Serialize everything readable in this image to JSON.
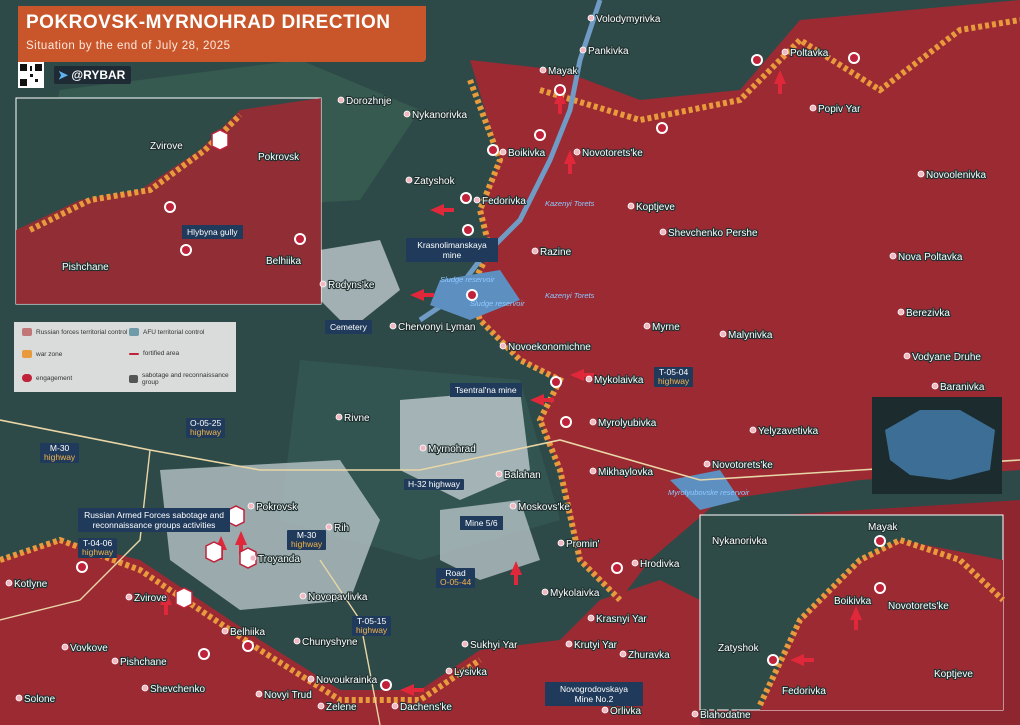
{
  "header": {
    "title": "POKROVSK-MYRNOHRAD DIRECTION",
    "subtitle": "Situation by the end of July 28, 2025"
  },
  "brand": {
    "handle": "@RYBAR"
  },
  "legend": {
    "russian": "Russian forces territorial control",
    "afu": "AFU territorial control",
    "war_zone": "war zone",
    "fortified": "fortified area",
    "engagement": "engagement",
    "sabotage": "sabotage and reconnaissance group"
  },
  "colors": {
    "russian_zone": "#9b2a33",
    "afu_zone": "#2e4a48",
    "war_zone": "#e89b3c",
    "settlement": "#d0d8dc",
    "callout_bg": "#1f3a5a",
    "highway_text": "#f5b54a",
    "header_bg": "#c8562a"
  },
  "icons": [
    "telegram-icon",
    "qr-code",
    "engagement-marker",
    "sabotage-marker",
    "settlement-marker",
    "advance-arrow"
  ],
  "settlements": [
    {
      "name": "Volodymyrivka"
    },
    {
      "name": "Pankivka"
    },
    {
      "name": "Mayak"
    },
    {
      "name": "Poltavka"
    },
    {
      "name": "Popiv Yar"
    },
    {
      "name": "Dorozhnje"
    },
    {
      "name": "Nykanorivka"
    },
    {
      "name": "Boikivka"
    },
    {
      "name": "Novotorets'ke"
    },
    {
      "name": "Novoolenivka"
    },
    {
      "name": "Zatyshok"
    },
    {
      "name": "Fedorivka"
    },
    {
      "name": "Koptjeve"
    },
    {
      "name": "Shevchenko Pershe"
    },
    {
      "name": "Razine"
    },
    {
      "name": "Nova Poltavka"
    },
    {
      "name": "Rodyns'ke"
    },
    {
      "name": "Chervonyi Lyman"
    },
    {
      "name": "Berezivka"
    },
    {
      "name": "Myrne"
    },
    {
      "name": "Malynivka"
    },
    {
      "name": "Novoekonomichne"
    },
    {
      "name": "Vodyane Druhe"
    },
    {
      "name": "Mykolaivka"
    },
    {
      "name": "Baranivka"
    },
    {
      "name": "Myrolyubivka"
    },
    {
      "name": "Yelyzavetivka"
    },
    {
      "name": "Rivne"
    },
    {
      "name": "Myrnohrad"
    },
    {
      "name": "Mikhaylovka"
    },
    {
      "name": "Novotorets'ke"
    },
    {
      "name": "Balahan"
    },
    {
      "name": "Pokrovsk"
    },
    {
      "name": "Moskovs'ke"
    },
    {
      "name": "Rih"
    },
    {
      "name": "Promin'"
    },
    {
      "name": "Troyanda"
    },
    {
      "name": "Hrodivka"
    },
    {
      "name": "Kotlyne"
    },
    {
      "name": "Zvirove"
    },
    {
      "name": "Novopavlivka"
    },
    {
      "name": "Mykolaivka"
    },
    {
      "name": "Belhiika"
    },
    {
      "name": "Krasnyi Yar"
    },
    {
      "name": "Vovkove"
    },
    {
      "name": "Pishchane"
    },
    {
      "name": "Chunyshyne"
    },
    {
      "name": "Sukhyi Yar"
    },
    {
      "name": "Krutyi Yar"
    },
    {
      "name": "Zhuravka"
    },
    {
      "name": "Shevchenko"
    },
    {
      "name": "Novoukrainka"
    },
    {
      "name": "Lysivka"
    },
    {
      "name": "Solone"
    },
    {
      "name": "Novyi Trud"
    },
    {
      "name": "Zelene"
    },
    {
      "name": "Dachens'ke"
    },
    {
      "name": "Orlivka"
    },
    {
      "name": "Blahodatne"
    }
  ],
  "water_labels": [
    "Kazenyi Torets",
    "Sludge reservoir",
    "Sludge reservoir",
    "Kazenyi Torets",
    "Myrolyubovske reservoir"
  ],
  "callouts": {
    "krasnolimanskaya": "Krasnolimanskaya mine",
    "cemetery": "Cemetery",
    "tsentral": "Tsentral'na mine",
    "mine56": "Mine 5/6",
    "novogrodovskaya": "Novogrodovskaya Mine No.2",
    "sabotage_note": "Russian Armed Forces sabotage and reconnaissance groups activities",
    "hlybyna": "Hlybyna gully"
  },
  "highways": [
    {
      "code": "M-30",
      "kind": "highway"
    },
    {
      "code": "O-05-25",
      "kind": "highway"
    },
    {
      "code": "T-05-04",
      "kind": "highway"
    },
    {
      "code": "H-32 highway",
      "kind": ""
    },
    {
      "code": "M-30",
      "kind": "highway"
    },
    {
      "code": "T-04-06",
      "kind": "highway"
    },
    {
      "code": "Road",
      "kind": "O-05-44"
    },
    {
      "code": "T-05-15",
      "kind": "highway"
    }
  ],
  "inset_left": {
    "labels": [
      "Zvirove",
      "Pokrovsk",
      "Pishchane",
      "Belhiika"
    ]
  },
  "inset_right": {
    "labels": [
      "Mayak",
      "Nykanorivka",
      "Boikivka",
      "Novotorets'ke",
      "Zatyshok",
      "Fedorivka",
      "Koptjeve"
    ]
  }
}
